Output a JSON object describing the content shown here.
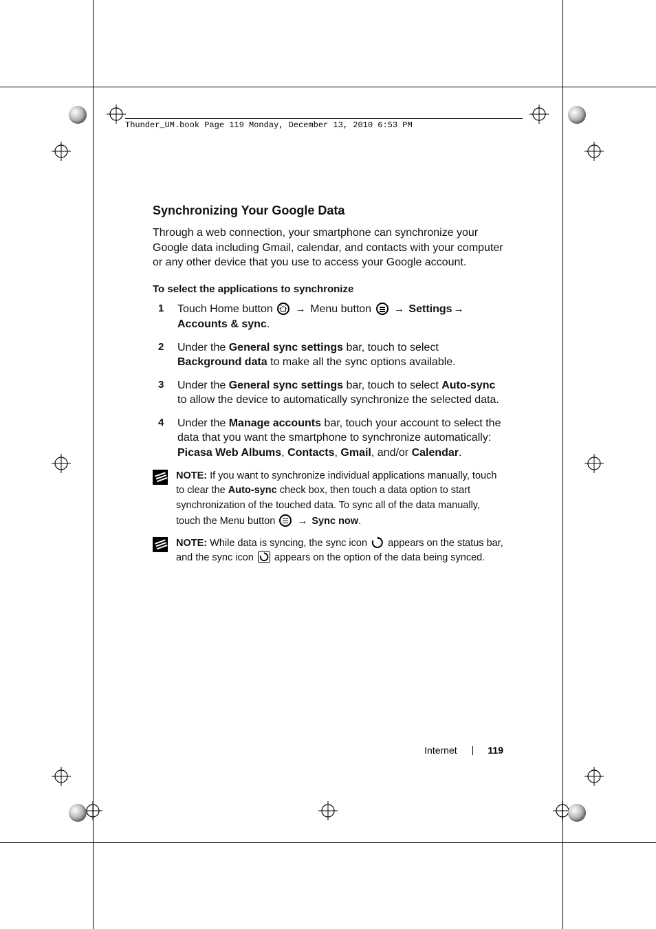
{
  "header": {
    "running_head": "Thunder_UM.book  Page 119  Monday, December 13, 2010  6:53 PM"
  },
  "section": {
    "title": "Synchronizing Your Google Data",
    "intro": "Through a web connection, your smartphone can synchronize your Google data including Gmail, calendar, and contacts with your computer or any other device that you use to access your Google account.",
    "subhead": "To select the applications to synchronize"
  },
  "steps": {
    "s1_a": "Touch Home button ",
    "s1_b": " Menu button ",
    "s1_c": " ",
    "s1_settings": "Settings",
    "s1_d": " ",
    "s1_accounts": "Accounts & sync",
    "s1_e": ".",
    "s2_a": "Under the ",
    "s2_b": "General sync settings",
    "s2_c": " bar, touch to select ",
    "s2_d": "Background data",
    "s2_e": " to make all the sync options available.",
    "s3_a": "Under the ",
    "s3_b": "General sync settings",
    "s3_c": " bar, touch to select ",
    "s3_d": "Auto-sync",
    "s3_e": " to allow the device to automatically synchronize the selected data.",
    "s4_a": "Under the ",
    "s4_b": "Manage accounts",
    "s4_c": " bar, touch your account to select the data that you want the smartphone to synchronize automatically: ",
    "s4_d": "Picasa Web Albums",
    "s4_e": ", ",
    "s4_f": "Contacts",
    "s4_g": ", ",
    "s4_h": "Gmail",
    "s4_i": ", and/or ",
    "s4_j": "Calendar",
    "s4_k": "."
  },
  "notes": {
    "n1_lead": "NOTE:",
    "n1_a": " If you want to synchronize individual applications manually, touch to clear the ",
    "n1_b": "Auto-sync",
    "n1_c": " check box, then touch a data option to start synchronization of the touched data. To sync all of the data manually, touch the Menu button ",
    "n1_d": " ",
    "n1_sync_now": "Sync now",
    "n1_e": ".",
    "n2_lead": "NOTE:",
    "n2_a": " While data is syncing, the sync icon ",
    "n2_b": " appears on the status bar, and the sync icon ",
    "n2_c": " appears on the option of the data being synced."
  },
  "footer": {
    "section_name": "Internet",
    "page_number": "119"
  },
  "glyphs": {
    "arrow": "→"
  }
}
